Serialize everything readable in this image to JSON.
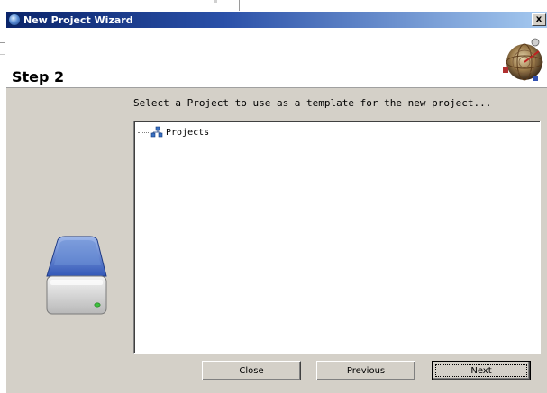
{
  "window": {
    "title": "New Project Wizard",
    "close_glyph": "x"
  },
  "header": {
    "step_title": "Step 2",
    "graphic_icon": "radar-globe-icon"
  },
  "main": {
    "instruction": "Select a Project to use as a template for the new project...",
    "tree": {
      "items": [
        {
          "label": "Projects",
          "icon": "projects-icon"
        }
      ]
    },
    "side_graphic_icon": "disk-drive-icon"
  },
  "buttons": {
    "close_label": "Close",
    "previous_label": "Previous",
    "next_label": "Next"
  },
  "colors": {
    "titlebar_start": "#0a246a",
    "titlebar_end": "#a6caf0",
    "dialog_face": "#d4d0c8"
  }
}
